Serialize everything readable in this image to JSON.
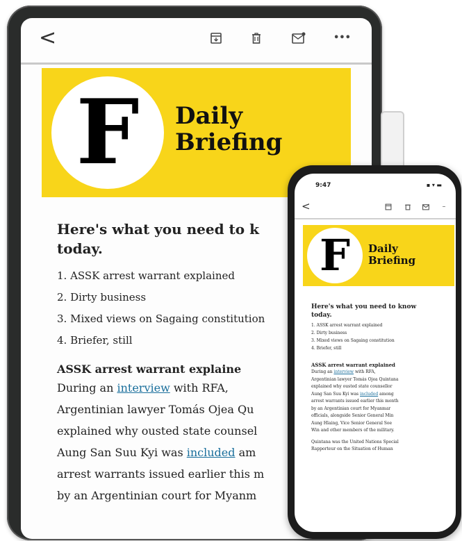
{
  "tablet": {
    "toolbar": {
      "back": "<",
      "archive": "archive-icon",
      "trash": "trash-icon",
      "mail": "mail-icon",
      "more": "•••"
    },
    "banner": {
      "letter": "F",
      "title_line1": "Daily",
      "title_line2": "Briefing",
      "color": "#f8d51a"
    },
    "intro_line1": "Here's what you need to k",
    "intro_line2": "today.",
    "list": [
      "1. ASSK arrest warrant explained",
      "2. Dirty business",
      "3. Mixed views on Sagaing constitution",
      "4. Briefer, still"
    ],
    "section_title": "ASSK arrest warrant explaine",
    "body": {
      "l1_pre": "During an ",
      "l1_link": "interview",
      "l1_post": " with RFA,",
      "l2": "Argentinian lawyer Tomás Ojea Qu",
      "l3": "explained why ousted state counsel",
      "l4_pre": "Aung San Suu Kyi was ",
      "l4_link": "included",
      "l4_post": " am",
      "l5": "arrest warrants issued earlier this m",
      "l6": "by an Argentinian court for Myanm"
    }
  },
  "phone": {
    "time": "9:47",
    "status": "▪ ▾ ▬",
    "back": "<",
    "banner": {
      "letter": "F",
      "title_line1": "Daily",
      "title_line2": "Briefing"
    },
    "intro_line1": "Here's what you need to know",
    "intro_line2": "today.",
    "list": [
      "1. ASSK arrest warrant explained",
      "2. Dirty business",
      "3. Mixed views on Sagaing constitution",
      "4. Briefer, still"
    ],
    "section_title": "ASSK arrest warrant explained",
    "body": {
      "l1_pre": "During an ",
      "l1_link": "interview",
      "l1_post": " with RFA,",
      "l2": "Argentinian lawyer Tomás Ojea Quintana",
      "l3": "explained why ousted state counsellor",
      "l4_pre": "Aung San Suu Kyi was ",
      "l4_link": "included",
      "l4_post": " among",
      "l5": "arrest warrants issued earlier this month",
      "l6": "by an Argentinian court for Myanmar",
      "l7": "officials, alongside Senior General Min",
      "l8": "Aung Hlaing, Vice Senior General Soe",
      "l9": "Win and other members of the military."
    },
    "body2": {
      "l1": "Quintana was the United Nations Special",
      "l2": "Rapporteur on the Situation of Human"
    }
  }
}
